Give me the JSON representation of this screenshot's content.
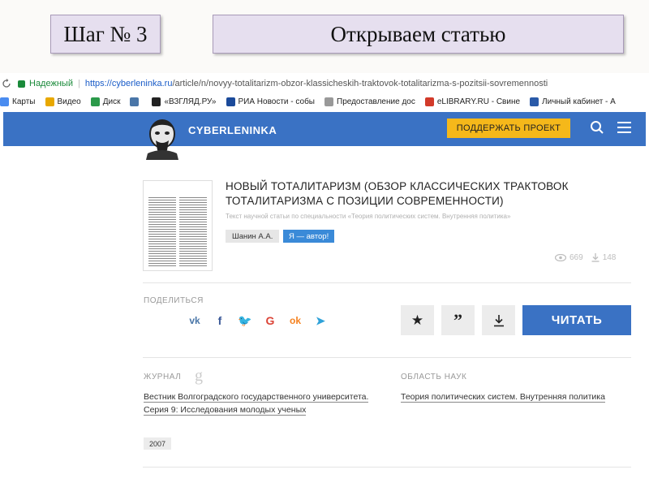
{
  "slide": {
    "step_label": "Шаг № 3",
    "title": "Открываем статью"
  },
  "browser": {
    "secure_label": "Надежный",
    "url_host": "https://cyberleninka.ru",
    "url_path": "/article/n/novyy-totalitarizm-obzor-klassicheskih-traktovok-totalitarizma-s-pozitsii-sovremennosti",
    "bookmarks": [
      {
        "label": "Карты",
        "icon": "maps-icon",
        "color": "#4a8cf0"
      },
      {
        "label": "Видео",
        "icon": "video-icon",
        "color": "#e8a800"
      },
      {
        "label": "Диск",
        "icon": "drive-icon",
        "color": "#2b9a4a"
      },
      {
        "label": "",
        "icon": "vk-icon",
        "color": "#4a76a8"
      },
      {
        "label": "«ВЗГЛЯД.РУ»",
        "icon": "vzglyad-icon",
        "color": "#222222"
      },
      {
        "label": "РИА Новости - собы",
        "icon": "ria-icon",
        "color": "#1b4a9a"
      },
      {
        "label": "Предоставление дос",
        "icon": "page-icon",
        "color": "#999999"
      },
      {
        "label": "eLIBRARY.RU - Свине",
        "icon": "elibrary-icon",
        "color": "#d23a2a"
      },
      {
        "label": "Личный кабинет - А",
        "icon": "shield-icon",
        "color": "#2a5aa8"
      }
    ]
  },
  "site": {
    "logo_text": "CYBERLENINKA",
    "support_label": "ПОДДЕРЖАТЬ ПРОЕКТ",
    "brand_color": "#3a72c4",
    "accent_color": "#f5b81a"
  },
  "article": {
    "title": "НОВЫЙ ТОТАЛИТАРИЗМ (ОБЗОР КЛАССИЧЕСКИХ ТРАКТОВОК ТОТАЛИТАРИЗМА С ПОЗИЦИИ СОВРЕМЕННОСТИ)",
    "subtitle": "Текст научной статьи по специальности «Теория политических систем. Внутренняя политика»",
    "author": "Шанин А.А.",
    "author_button": "Я — автор!",
    "views": "669",
    "downloads": "148"
  },
  "share": {
    "label": "ПОДЕЛИТЬСЯ",
    "networks": [
      {
        "name": "vk-icon",
        "glyph": "vk",
        "color": "#4a76a8"
      },
      {
        "name": "facebook-icon",
        "glyph": "f",
        "color": "#3b5998"
      },
      {
        "name": "twitter-icon",
        "glyph": "🐦",
        "color": "#1da1f2"
      },
      {
        "name": "google-icon",
        "glyph": "G",
        "color": "#db4437"
      },
      {
        "name": "odnoklassniki-icon",
        "glyph": "ok",
        "color": "#f58220"
      },
      {
        "name": "telegram-icon",
        "glyph": "➤",
        "color": "#2fa2d9"
      }
    ]
  },
  "actions": {
    "read_label": "ЧИТАТЬ"
  },
  "journal": {
    "label": "ЖУРНАЛ",
    "name": "Вестник Волгоградского государственного университета. Серия 9: Исследования молодых ученых",
    "year": "2007"
  },
  "field": {
    "label": "ОБЛАСТЬ НАУК",
    "name": "Теория политических систем. Внутренняя политика"
  }
}
